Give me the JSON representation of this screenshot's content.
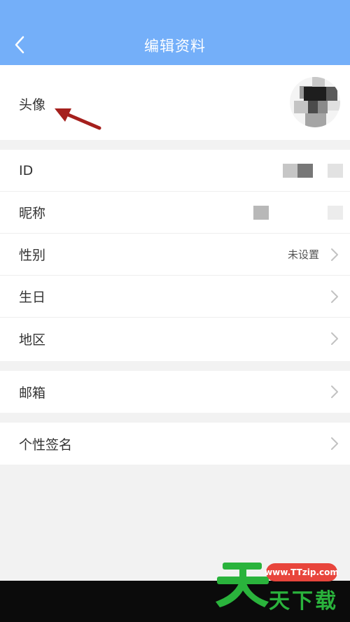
{
  "header": {
    "title": "编辑资料",
    "back_icon": "chevron-left-icon",
    "bg_color": "#74aff9"
  },
  "profile": {
    "avatar_label": "头像",
    "annotation": "red-arrow-pointing-to-avatar-label"
  },
  "info": {
    "id_label": "ID",
    "nickname_label": "昵称",
    "gender_label": "性别",
    "gender_value": "未设置",
    "birthday_label": "生日",
    "region_label": "地区"
  },
  "contact": {
    "email_label": "邮箱"
  },
  "bio": {
    "signature_label": "个性签名"
  },
  "watermark": {
    "url": "www.TTzip.com",
    "text": "天下载",
    "logo_glyph": "天"
  }
}
